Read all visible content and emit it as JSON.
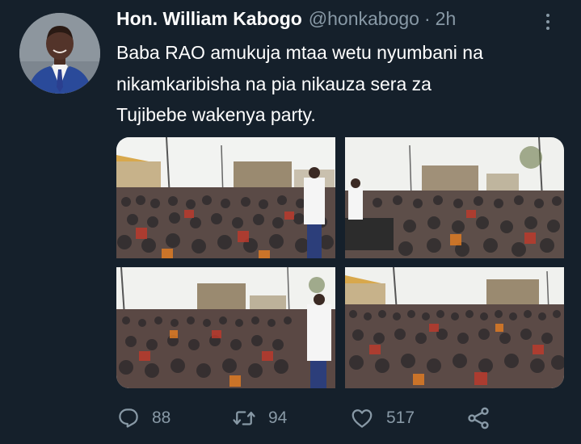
{
  "tweet": {
    "display_name": "Hon. William Kabogo",
    "handle": "@honkabogo",
    "separator": "·",
    "time": "2h",
    "text_lines": [
      "Baba RAO amukuja mtaa wetu nyumbani na",
      "nikamkaribisha na pia nikauza sera za",
      "Tujibebe wakenya party."
    ],
    "photos": [
      {
        "icon": "rally-photo-1"
      },
      {
        "icon": "rally-photo-2"
      },
      {
        "icon": "rally-photo-3"
      },
      {
        "icon": "rally-photo-4"
      }
    ]
  },
  "actions": {
    "reply": {
      "icon": "reply-icon",
      "count": "88"
    },
    "retweet": {
      "icon": "retweet-icon",
      "count": "94"
    },
    "like": {
      "icon": "heart-icon",
      "count": "517"
    },
    "share": {
      "icon": "share-icon"
    }
  },
  "colors": {
    "background": "#15202b",
    "primary_text": "#ffffff",
    "secondary_text": "#8899a6"
  }
}
